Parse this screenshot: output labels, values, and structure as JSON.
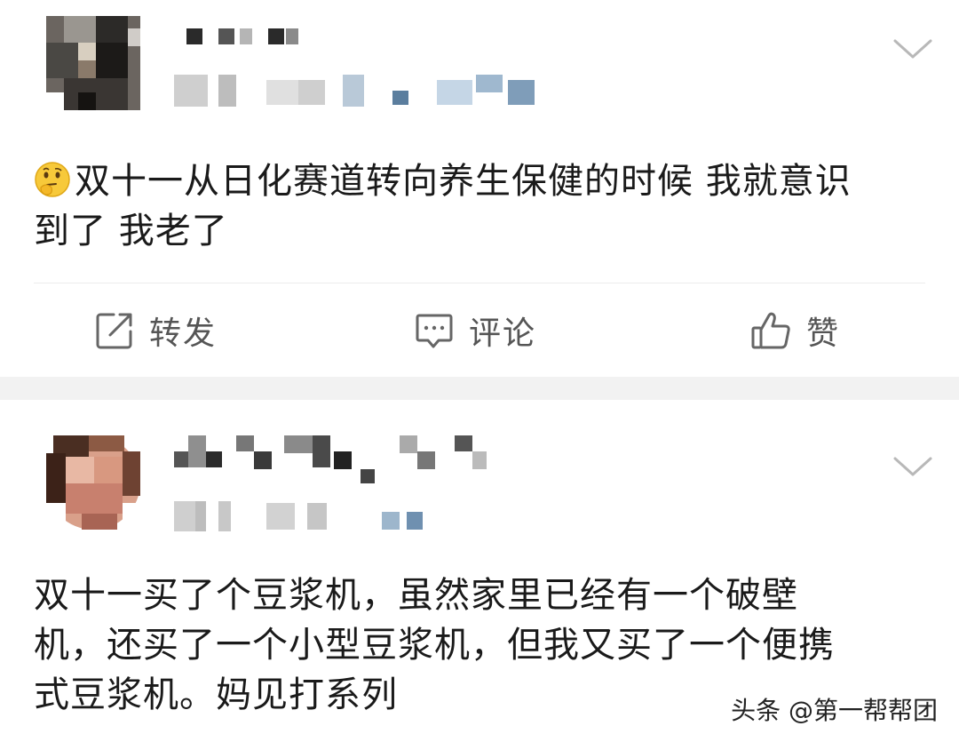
{
  "post1": {
    "text": "双十一从日化赛道转向养生保健的时候 我就意识到了 我老了",
    "text_line1": "双十一从日化赛道转向养生保健的时候 我就意识",
    "text_line2": "到了 我老了",
    "emoji": "thinking-face-icon"
  },
  "actions": {
    "repost": "转发",
    "comment": "评论",
    "like": "赞"
  },
  "post2": {
    "text_line1": "双十一买了个豆浆机，虽然家里已经有一个破壁",
    "text_line2": "机，还买了一个小型豆浆机，但我又买了一个便携",
    "text_line3": "式豆浆机。妈见打系列"
  },
  "watermark": "头条 @第一帮帮团"
}
